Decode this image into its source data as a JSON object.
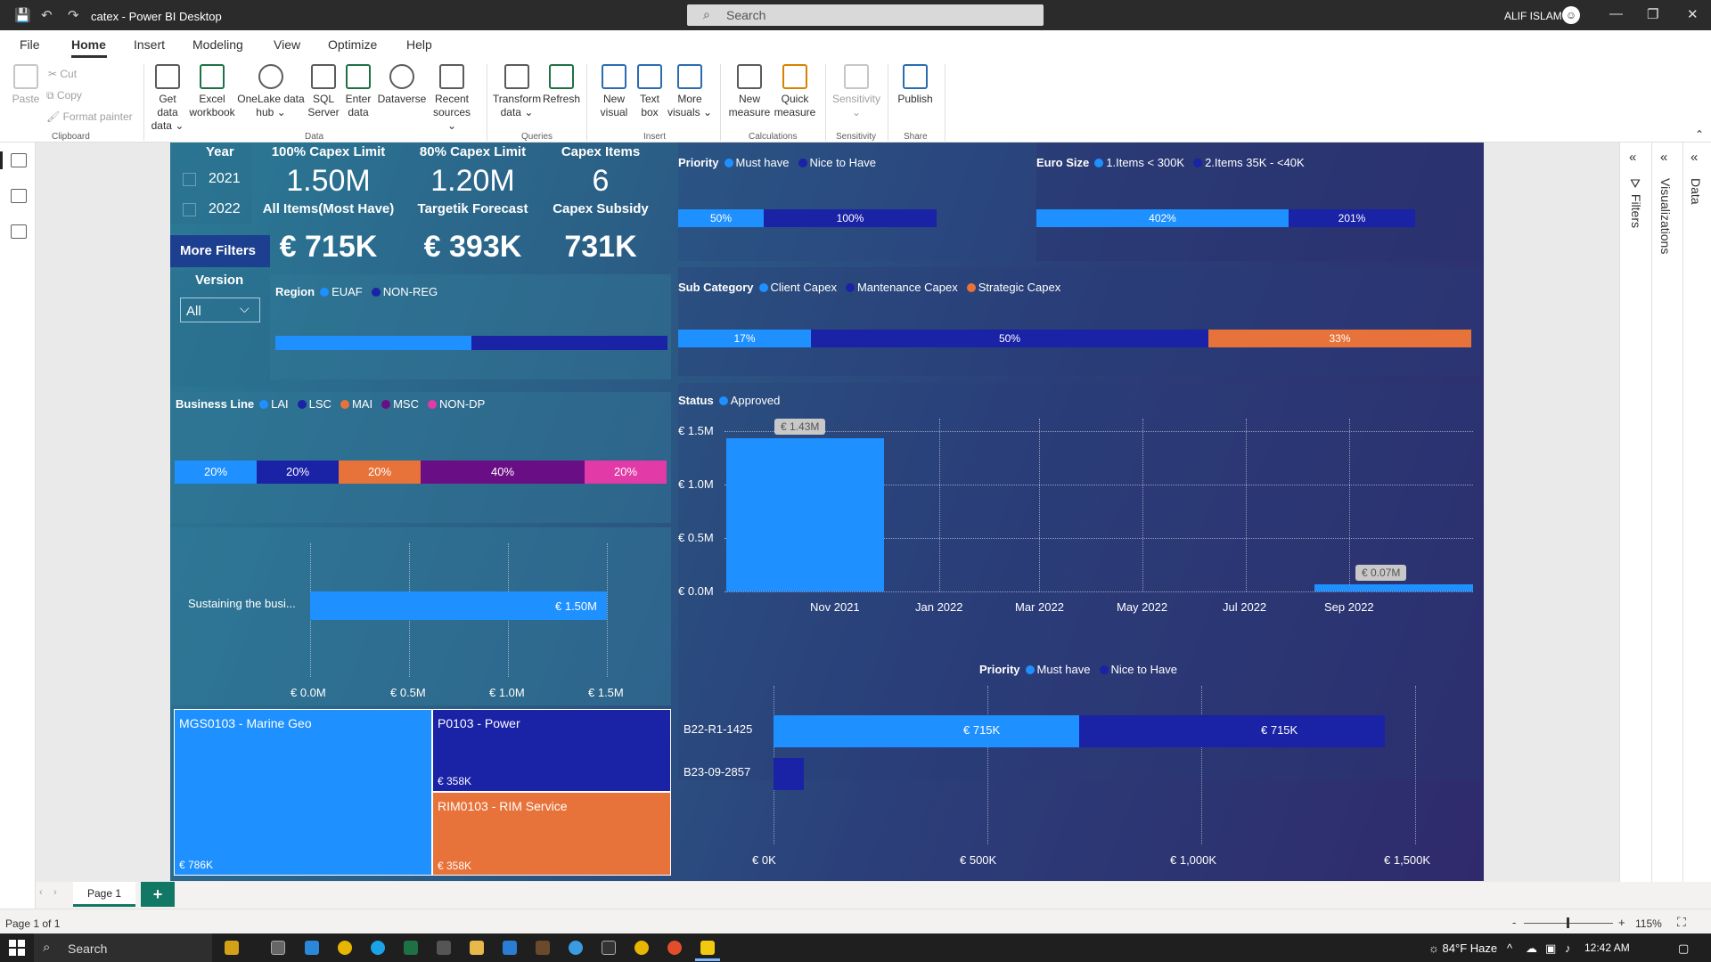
{
  "window": {
    "title": "catex - Power BI Desktop",
    "search_placeholder": "Search",
    "user_name": "ALIF ISLAM"
  },
  "menu": [
    "File",
    "Home",
    "Insert",
    "Modeling",
    "View",
    "Optimize",
    "Help"
  ],
  "ribbon": {
    "clipboard": {
      "paste": "Paste",
      "cut": "Cut",
      "copy": "Copy",
      "format_painter": "Format painter",
      "label": "Clipboard"
    },
    "data": {
      "get_data": "Get data",
      "get_data_2": "data ⌄",
      "excel": "Excel",
      "excel_2": "workbook",
      "onelake": "OneLake data",
      "onelake_2": "hub ⌄",
      "sql": "SQL",
      "sql_2": "Server",
      "enter": "Enter",
      "enter_2": "data",
      "dataverse": "Dataverse",
      "recent": "Recent",
      "recent_2": "sources ⌄",
      "label": "Data"
    },
    "queries": {
      "transform": "Transform",
      "transform_2": "data ⌄",
      "refresh": "Refresh",
      "label": "Queries"
    },
    "insert": {
      "new_visual": "New",
      "new_visual_2": "visual",
      "text_box": "Text",
      "text_box_2": "box",
      "more_visuals": "More",
      "more_visuals_2": "visuals ⌄",
      "label": "Insert"
    },
    "calculations": {
      "new_measure": "New",
      "new_measure_2": "measure",
      "quick_measure": "Quick",
      "quick_measure_2": "measure",
      "label": "Calculations"
    },
    "sensitivity": {
      "btn": "Sensitivity",
      "btn_2": "⌄",
      "label": "Sensitivity"
    },
    "share": {
      "publish": "Publish",
      "label": "Share"
    }
  },
  "report": {
    "year_slicer": {
      "title": "Year",
      "options": [
        "2021",
        "2022"
      ]
    },
    "kpis": [
      {
        "label": "100% Capex Limit",
        "value": "1.50M",
        "sub_label": "All Items(Most Have)",
        "sub_value": "€ 715K"
      },
      {
        "label": "80% Capex Limit",
        "value": "1.20M",
        "sub_label": "Targetik Forecast",
        "sub_value": "€ 393K"
      },
      {
        "label": "Capex Items",
        "value": "6",
        "sub_label": "Capex Subsidy",
        "sub_value": "731K"
      }
    ],
    "more_filters": "More Filters",
    "version": {
      "title": "Version",
      "value": "All"
    },
    "region": {
      "title": "Region",
      "items": [
        "EUAF",
        "NON-REG"
      ]
    },
    "priority_top": {
      "title": "Priority",
      "items": [
        "Must have",
        "Nice to Have"
      ],
      "values": [
        "50%",
        "100%"
      ]
    },
    "euro_size": {
      "title": "Euro Size",
      "items": [
        "1.Items < 300K",
        "2.Items 35K - <40K"
      ],
      "values": [
        "402%",
        "201%"
      ]
    },
    "sub_category": {
      "title": "Sub Category",
      "items": [
        "Client  Capex",
        "Mantenance Capex",
        "Strategic Capex"
      ],
      "values": [
        "17%",
        "50%",
        "33%"
      ]
    },
    "business_line": {
      "title": "Business Line",
      "items": [
        "LAI",
        "LSC",
        "MAI",
        "MSC",
        "NON-DP"
      ],
      "values": [
        "20%",
        "20%",
        "20%",
        "40%",
        "20%"
      ]
    },
    "sustaining": {
      "category": "Sustaining the busi...",
      "value_label": "€ 1.50M",
      "ticks": [
        "€ 0.0M",
        "€ 0.5M",
        "€ 1.0M",
        "€ 1.5M"
      ]
    },
    "treemap": [
      {
        "name": "MGS0103 - Marine Geo",
        "value": "€ 786K"
      },
      {
        "name": "P0103 - Power",
        "value": "€ 358K"
      },
      {
        "name": "RIM0103 - RIM Service",
        "value": "€ 358K"
      }
    ],
    "status_chart": {
      "title": "Status",
      "legend": "Approved",
      "y_ticks": [
        "€ 1.5M",
        "€ 1.0M",
        "€ 0.5M",
        "€ 0.0M"
      ],
      "x_ticks": [
        "Nov 2021",
        "Jan 2022",
        "Mar 2022",
        "May 2022",
        "Jul 2022",
        "Sep 2022"
      ],
      "labels": [
        "€ 1.43M",
        "€ 0.07M"
      ]
    },
    "priority_bottom": {
      "title": "Priority",
      "items": [
        "Must have",
        "Nice to Have"
      ],
      "rows": [
        "B22-R1-1425",
        "B23-09-2857"
      ],
      "labels": [
        "€ 715K",
        "€ 715K"
      ],
      "x_ticks": [
        "€ 0K",
        "€ 500K",
        "€ 1,000K",
        "€ 1,500K"
      ]
    }
  },
  "panes": {
    "filters": "Filters",
    "visualizations": "Visualizations",
    "data": "Data"
  },
  "pages": {
    "tab": "Page 1",
    "add": "+"
  },
  "status": {
    "page_count": "Page 1 of 1",
    "zoom": "115%"
  },
  "taskbar": {
    "search": "Search",
    "weather": "84°F  Haze",
    "time": "12:42 AM"
  },
  "colors": {
    "bright_blue": "#1e90ff",
    "navy": "#1a22a6",
    "orange": "#e8733a",
    "purple": "#6a0e86",
    "pink": "#e23aa6",
    "teal_green": "#117865"
  },
  "chart_data": [
    {
      "type": "bar",
      "title": "Status",
      "series": [
        {
          "name": "Approved",
          "values": [
            1.43,
            0.07
          ]
        }
      ],
      "x": [
        "Oct 2021",
        "Sep 2022"
      ],
      "ylabel": "",
      "ylim": [
        0,
        1.6
      ],
      "y_unit": "€ M"
    },
    {
      "type": "bar",
      "title": "Priority",
      "orientation": "horizontal",
      "stacked": true,
      "categories": [
        "B22-R1-1425",
        "B23-09-2857"
      ],
      "series": [
        {
          "name": "Must have",
          "values": [
            715,
            0
          ]
        },
        {
          "name": "Nice to Have",
          "values": [
            715,
            70
          ]
        }
      ],
      "xlim": [
        0,
        1500
      ],
      "x_unit": "€ K"
    },
    {
      "type": "bar",
      "orientation": "horizontal",
      "categories": [
        "Sustaining the busi..."
      ],
      "values": [
        1.5
      ],
      "xlim": [
        0,
        1.5
      ],
      "x_unit": "€ M"
    }
  ]
}
